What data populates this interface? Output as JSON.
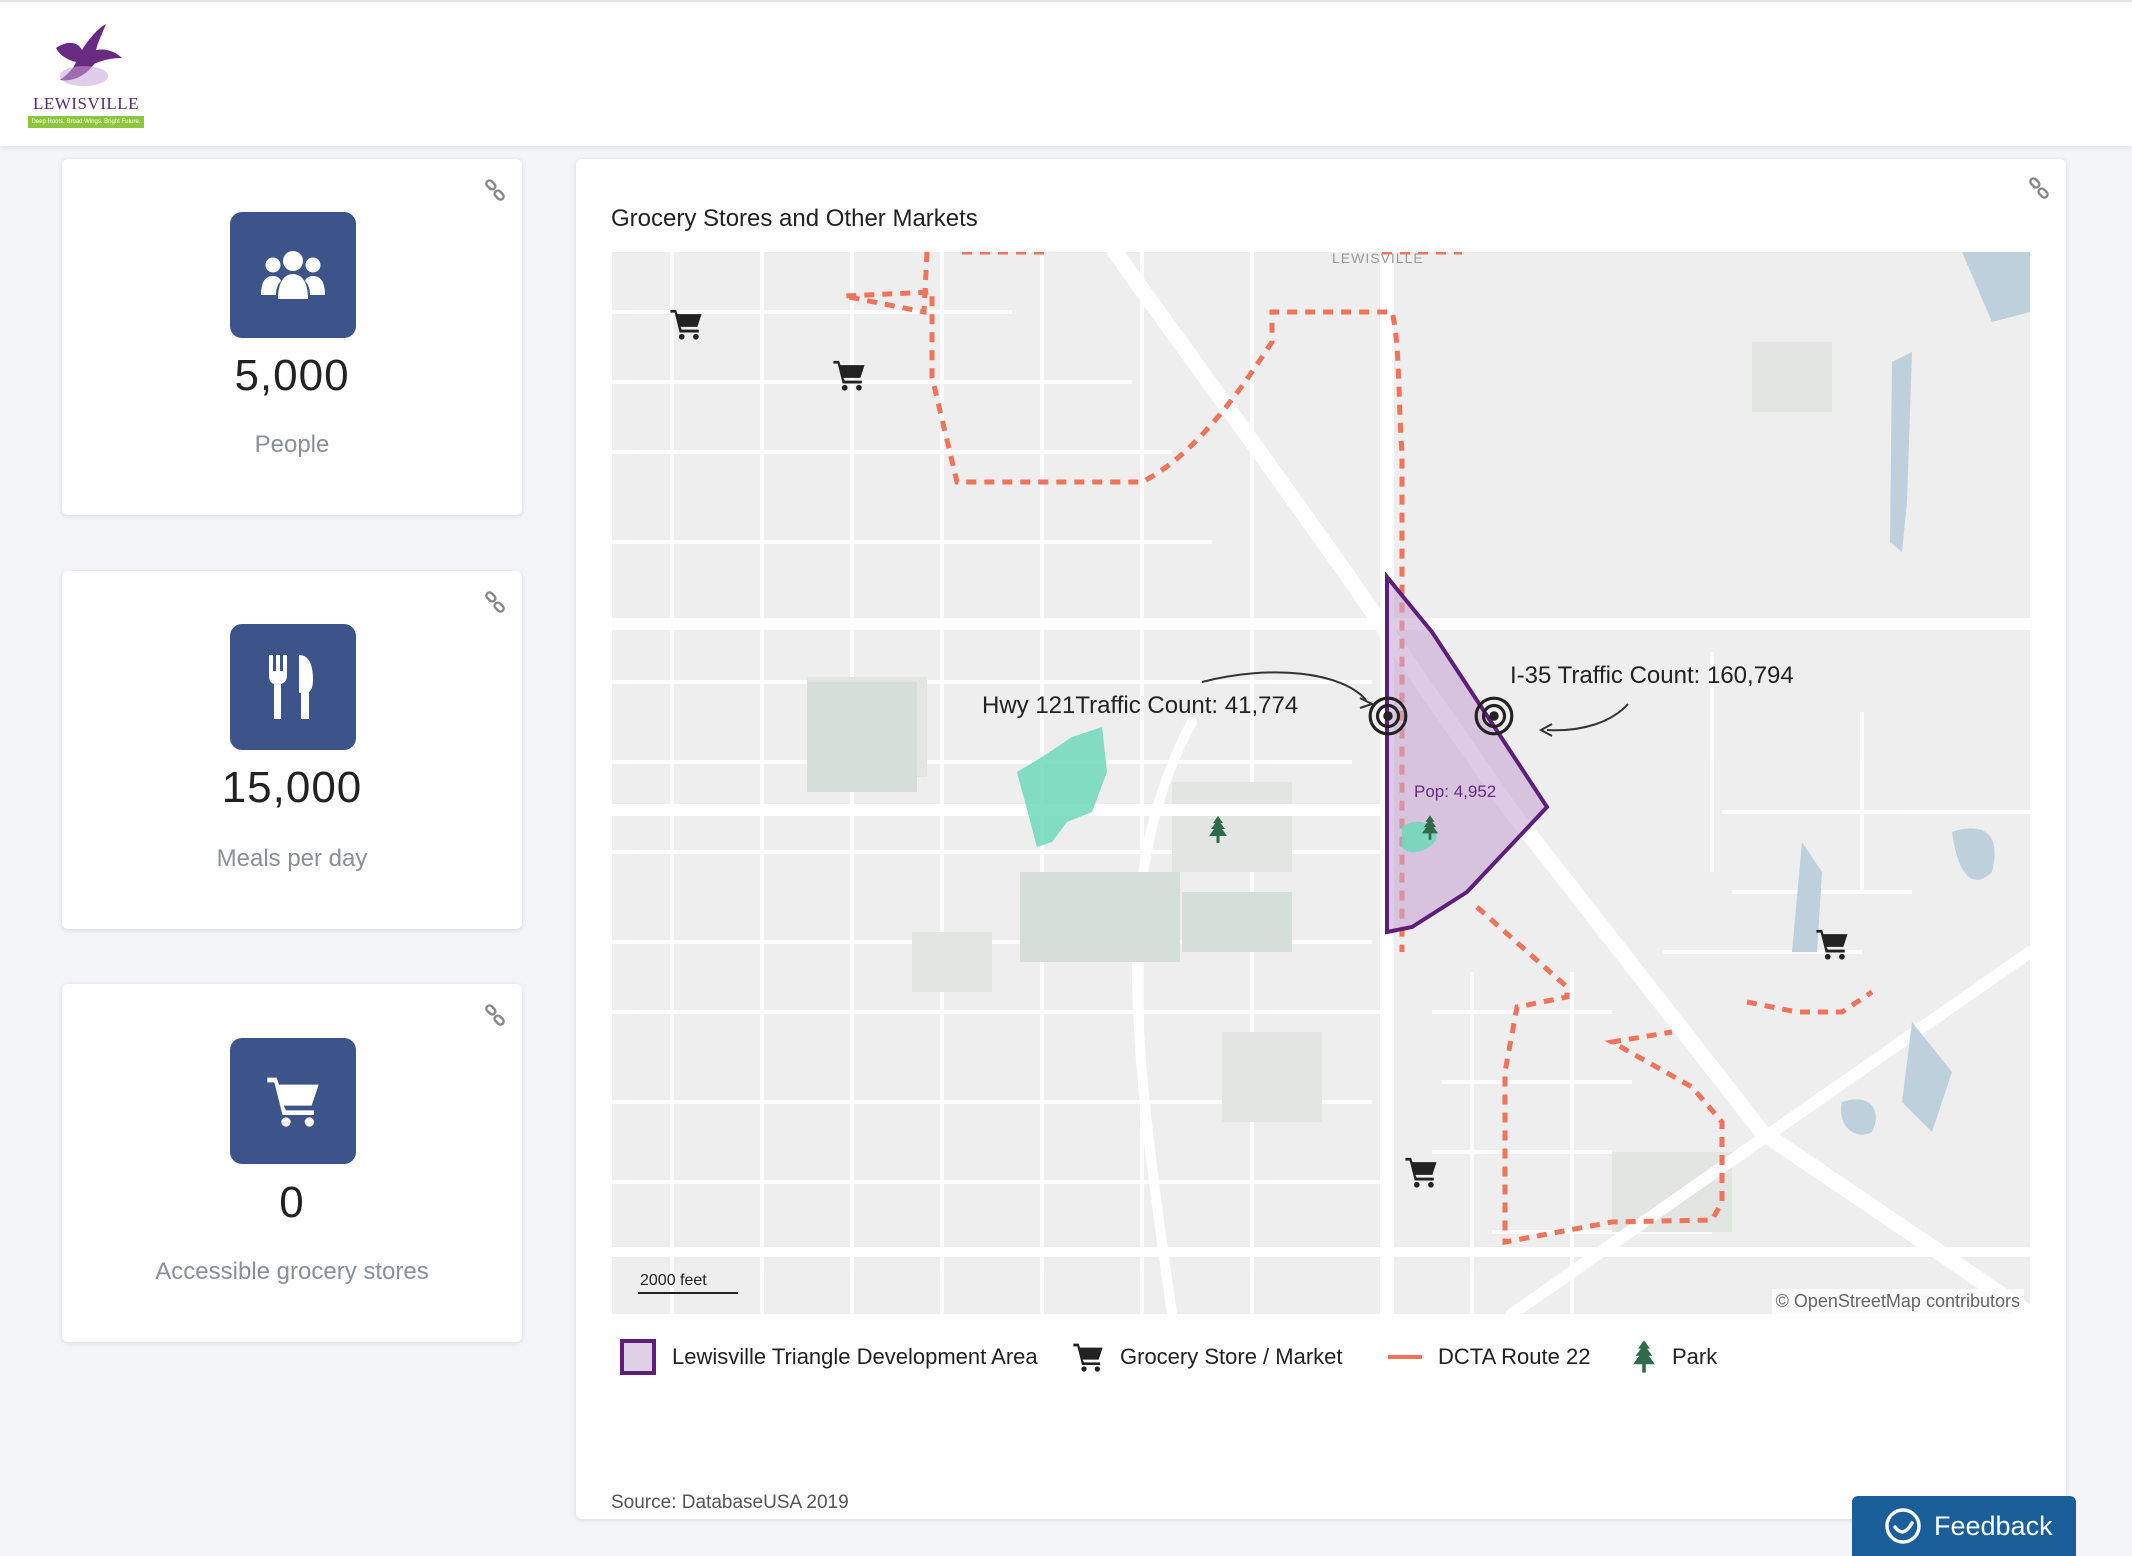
{
  "brand": {
    "logo_text": "LEWISVILLE",
    "tagline": "Deep Roots. Broad Wings. Bright Future."
  },
  "stats": [
    {
      "value": "5,000",
      "label": "People",
      "icon": "people-icon"
    },
    {
      "value": "15,000",
      "label": "Meals per day",
      "icon": "fork-knife-icon"
    },
    {
      "value": "0",
      "label": "Accessible grocery stores",
      "icon": "shopping-cart-icon"
    }
  ],
  "map_card": {
    "title": "Grocery Stores and Other Markets",
    "city_label": "LEWISVILLE",
    "hwy121_label": "Hwy 121Traffic Count: 41,774",
    "i35_label": "I-35 Traffic Count: 160,794",
    "pop_label": "Pop: 4,952",
    "scale_label": "2000 feet",
    "attribution": "© OpenStreetMap contributors",
    "source": "Source: DatabaseUSA 2019"
  },
  "legend": [
    {
      "label": "Lewisville Triangle Development Area",
      "icon": "area-swatch-icon"
    },
    {
      "label": "Grocery Store / Market",
      "icon": "shopping-cart-icon"
    },
    {
      "label": "DCTA Route 22",
      "icon": "route-line-icon"
    },
    {
      "label": "Park",
      "icon": "tree-icon"
    }
  ],
  "colors": {
    "stat_icon_bg": "#3c5489",
    "area_stroke": "#5e1f7a",
    "area_fill": "#c9a6d6",
    "route": "#f0735a",
    "park": "#6fd8b8",
    "feedback_bg": "#1a5e9a"
  },
  "feedback": {
    "label": "Feedback"
  }
}
